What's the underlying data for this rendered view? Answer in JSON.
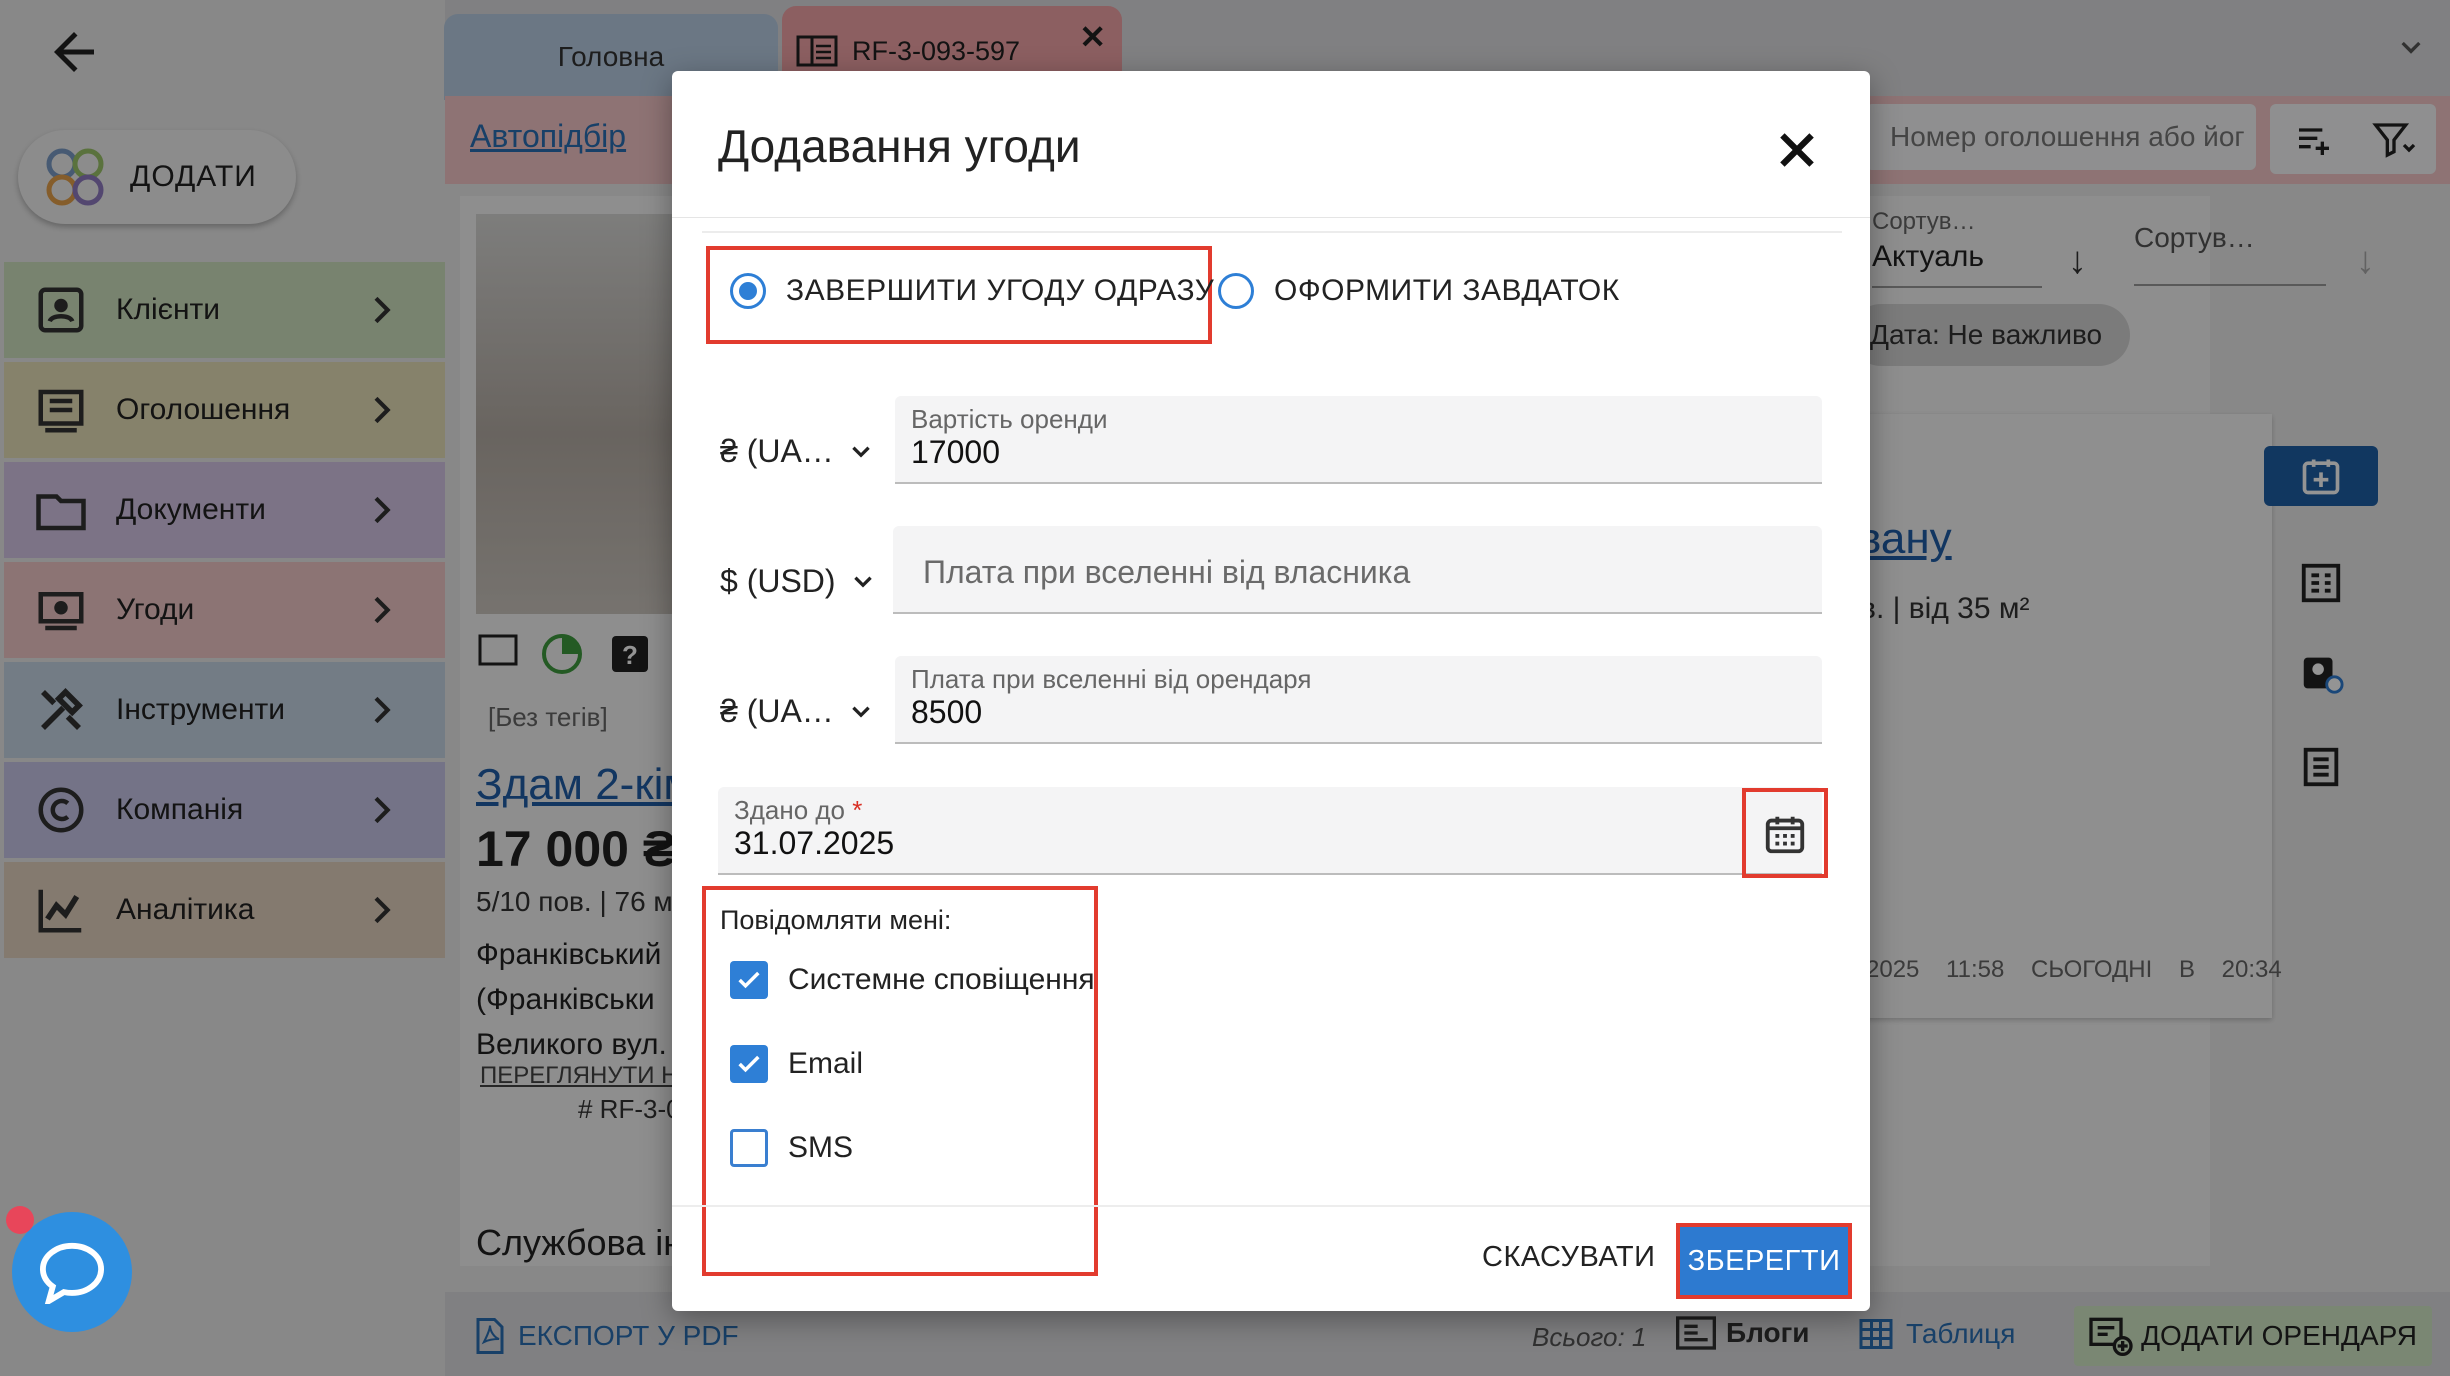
{
  "sidebar": {
    "add_label": "ДОДАТИ",
    "items": [
      {
        "label": "Клієнти",
        "color": "#cfe2bf",
        "icon": "contacts-icon"
      },
      {
        "label": "Оголошення",
        "color": "#e7e1b8",
        "icon": "listing-icon"
      },
      {
        "label": "Документи",
        "color": "#d6c7e7",
        "icon": "folder-icon"
      },
      {
        "label": "Угоди",
        "color": "#f1c9c9",
        "icon": "deal-icon"
      },
      {
        "label": "Інструменти",
        "color": "#c7d6e6",
        "icon": "tools-icon"
      },
      {
        "label": "Компанія",
        "color": "#c8c7e8",
        "icon": "copyright-icon"
      },
      {
        "label": "Аналітика",
        "color": "#e3d2bf",
        "icon": "analytics-icon"
      }
    ]
  },
  "tabs": {
    "home": "Головна",
    "record": "RF-3-093-597"
  },
  "toolbar": {
    "autopick": "Автопідбір",
    "search_placeholder": "Номер оголошення або йог"
  },
  "listing": {
    "tags": "[Без тегів]",
    "title": "Здам 2-кім",
    "price": "17 000 ₴",
    "floor": "5/10 пов. | 76 м",
    "address_line1": "Франківський",
    "address_line2": "(Франківськи",
    "address_line3": "Великого вул.",
    "view_link": "ПЕРЕГЛЯНУТИ Н",
    "id": "# RF-3-0",
    "service": "Службова ін"
  },
  "right_panel": {
    "sort1_label": "Сортув…",
    "sort1_value": "Актуаль",
    "sort2_label": "Сортув…",
    "date_chip": "Дата: Не важливо",
    "link": "вану",
    "sub": "в. | від 35 м²",
    "date1": "2025 11:58",
    "date2": "СЬОГОДНІ В 20:34"
  },
  "bottom": {
    "export": "ЕКСПОРТ У PDF",
    "total": "Всього: 1",
    "blogs": "Блоги",
    "table": "Таблиця",
    "add_tenant": "ДОДАТИ ОРЕНДАРЯ"
  },
  "modal": {
    "title": "Додавання угоди",
    "radio_complete": "ЗАВЕРШИТИ УГОДУ ОДРАЗУ",
    "radio_deposit": "ОФОРМИТИ ЗАВДАТОК",
    "row1": {
      "currency": "₴ (UA…",
      "label": "Вартість оренди",
      "value": "17000"
    },
    "row2": {
      "currency": "$ (USD)",
      "placeholder": "Плата при вселенні від власника"
    },
    "row3": {
      "currency": "₴ (UA…",
      "label": "Плата при вселенні від орендаря",
      "value": "8500"
    },
    "date": {
      "label": "Здано до",
      "required_mark": "*",
      "value": "31.07.2025"
    },
    "notify_title": "Повідомляти мені:",
    "notify": [
      {
        "label": "Системне сповіщення",
        "checked": true
      },
      {
        "label": "Email",
        "checked": true
      },
      {
        "label": "SMS",
        "checked": false
      }
    ],
    "cancel": "СКАСУВАТИ",
    "save": "ЗБЕРЕГТИ"
  },
  "colors": {
    "accent": "#2d7ad0",
    "highlight": "#e23b2e"
  }
}
